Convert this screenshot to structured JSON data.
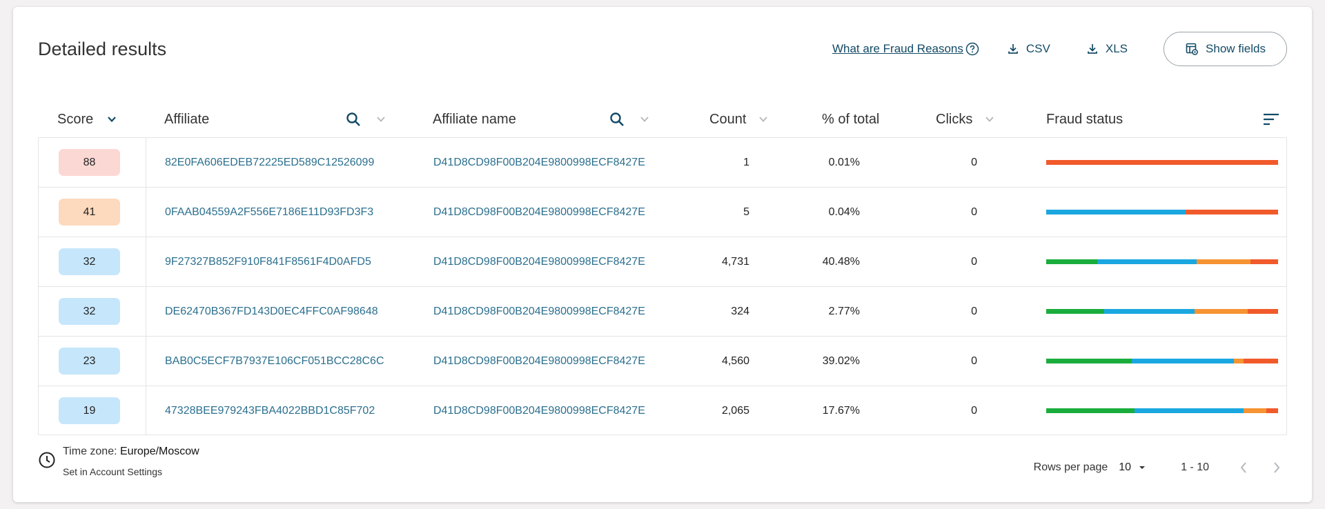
{
  "title": "Detailed results",
  "toolbar": {
    "fraud_reasons_link": "What are Fraud Reasons",
    "csv_label": "CSV",
    "xls_label": "XLS",
    "show_fields_label": "Show fields"
  },
  "columns": {
    "score": "Score",
    "affiliate": "Affiliate",
    "affiliate_name": "Affiliate name",
    "count": "Count",
    "percent_total": "% of total",
    "clicks": "Clicks",
    "fraud_status": "Fraud status"
  },
  "colors": {
    "green": "#1aad3c",
    "blue": "#1aa7e0",
    "orange": "#f69332",
    "red": "#f15a2b",
    "badge_red": "#fcd8d4",
    "badge_orange": "#fdd9bd",
    "badge_blue": "#c6e6fb"
  },
  "rows": [
    {
      "score": "88",
      "badge": "badge_red",
      "affiliate": "82E0FA606EDEB72225ED589C12526099",
      "affiliate_name": "D41D8CD98F00B204E9800998ECF8427E",
      "count": "1",
      "percent": "0.01%",
      "clicks": "0",
      "fraud_status": [
        {
          "color": "red",
          "share": 1.0
        }
      ]
    },
    {
      "score": "41",
      "badge": "badge_orange",
      "affiliate": "0FAAB04559A2F556E7186E11D93FD3F3",
      "affiliate_name": "D41D8CD98F00B204E9800998ECF8427E",
      "count": "5",
      "percent": "0.04%",
      "clicks": "0",
      "fraud_status": [
        {
          "color": "blue",
          "share": 0.6
        },
        {
          "color": "red",
          "share": 0.4
        }
      ]
    },
    {
      "score": "32",
      "badge": "badge_blue",
      "affiliate": "9F27327B852F910F841F8561F4D0AFD5",
      "affiliate_name": "D41D8CD98F00B204E9800998ECF8427E",
      "count": "4,731",
      "percent": "40.48%",
      "clicks": "0",
      "fraud_status": [
        {
          "color": "green",
          "share": 0.22
        },
        {
          "color": "blue",
          "share": 0.43
        },
        {
          "color": "orange",
          "share": 0.23
        },
        {
          "color": "red",
          "share": 0.12
        }
      ]
    },
    {
      "score": "32",
      "badge": "badge_blue",
      "affiliate": "DE62470B367FD143D0EC4FFC0AF98648",
      "affiliate_name": "D41D8CD98F00B204E9800998ECF8427E",
      "count": "324",
      "percent": "2.77%",
      "clicks": "0",
      "fraud_status": [
        {
          "color": "green",
          "share": 0.25
        },
        {
          "color": "blue",
          "share": 0.39
        },
        {
          "color": "orange",
          "share": 0.23
        },
        {
          "color": "red",
          "share": 0.13
        }
      ]
    },
    {
      "score": "23",
      "badge": "badge_blue",
      "affiliate": "BAB0C5ECF7B7937E106CF051BCC28C6C",
      "affiliate_name": "D41D8CD98F00B204E9800998ECF8427E",
      "count": "4,560",
      "percent": "39.02%",
      "clicks": "0",
      "fraud_status": [
        {
          "color": "green",
          "share": 0.37
        },
        {
          "color": "blue",
          "share": 0.44
        },
        {
          "color": "orange",
          "share": 0.04
        },
        {
          "color": "red",
          "share": 0.15
        }
      ]
    },
    {
      "score": "19",
      "badge": "badge_blue",
      "affiliate": "47328BEE979243FBA4022BBD1C85F702",
      "affiliate_name": "D41D8CD98F00B204E9800998ECF8427E",
      "count": "2,065",
      "percent": "17.67%",
      "clicks": "0",
      "fraud_status": [
        {
          "color": "green",
          "share": 0.38
        },
        {
          "color": "blue",
          "share": 0.47
        },
        {
          "color": "orange",
          "share": 0.1
        },
        {
          "color": "red",
          "share": 0.05
        }
      ]
    }
  ],
  "footer": {
    "timezone_label": "Time zone:",
    "timezone_value": "Europe/Moscow",
    "timezone_sub": "Set in Account Settings",
    "rows_per_page_label": "Rows per page",
    "rows_per_page_value": "10",
    "range": "1 - 10"
  }
}
